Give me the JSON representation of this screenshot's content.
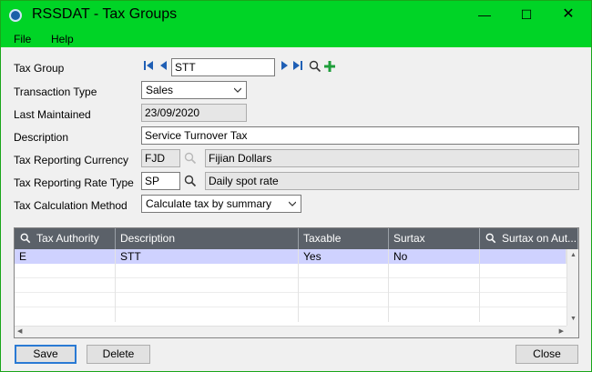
{
  "window": {
    "title": "RSSDAT - Tax Groups",
    "minimize": "—",
    "maximize": "☐",
    "close": "✕"
  },
  "menu": {
    "file": "File",
    "help": "Help"
  },
  "form": {
    "tax_group_label": "Tax Group",
    "tax_group_value": "STT",
    "transaction_type_label": "Transaction Type",
    "transaction_type_value": "Sales",
    "last_maintained_label": "Last Maintained",
    "last_maintained_value": "23/09/2020",
    "description_label": "Description",
    "description_value": "Service Turnover Tax",
    "reporting_currency_label": "Tax Reporting Currency",
    "reporting_currency_code": "FJD",
    "reporting_currency_name": "Fijian Dollars",
    "reporting_rate_type_label": "Tax Reporting Rate Type",
    "reporting_rate_type_code": "SP",
    "reporting_rate_type_name": "Daily spot rate",
    "calculation_method_label": "Tax Calculation Method",
    "calculation_method_value": "Calculate tax by summary"
  },
  "grid": {
    "columns": [
      "Tax Authority",
      "Description",
      "Taxable",
      "Surtax",
      "Surtax on Aut..."
    ],
    "rows": [
      [
        "E",
        "STT",
        "Yes",
        "No",
        ""
      ]
    ]
  },
  "buttons": {
    "save": "Save",
    "delete": "Delete",
    "close": "Close"
  },
  "colors": {
    "titlebar": "#00d426",
    "grid_header": "#5b6169",
    "selected_row": "#cfd2ff",
    "add_icon": "#1e9e3a",
    "nav_icon": "#1f5fb5"
  },
  "icons": {
    "navigation": [
      "first-record-icon",
      "previous-record-icon",
      "next-record-icon",
      "last-record-icon"
    ],
    "lookup": "finder-icon",
    "add": "plus-icon"
  }
}
